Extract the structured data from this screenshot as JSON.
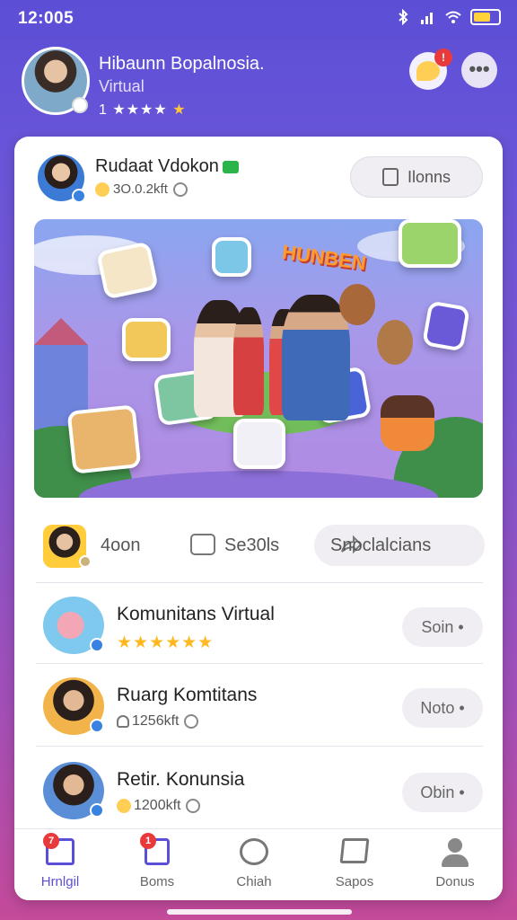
{
  "status_bar": {
    "time": "12:005"
  },
  "header": {
    "name": "Hibaunn Bopalnosia.",
    "subtitle": "Virtual",
    "rating_prefix": "1",
    "rating_stars": "★★★★",
    "rating_gold_star": "★",
    "chat_badge": "!",
    "more_label": "•••"
  },
  "post": {
    "author": "Rudaat Vdokon",
    "meta": "3O.0.2kft",
    "follow_label": "Ilonns",
    "hero_title": "HUNBEN"
  },
  "actions": {
    "like_label": "4oon",
    "comment_label": "Se30ls",
    "share_label": "Snoclalcians"
  },
  "communities": [
    {
      "title": "Komunitans Virtual",
      "sub_stars": "★★★★★★",
      "button": "Soin •"
    },
    {
      "title": "Ruarg Komtitans",
      "sub_text": "1256kft",
      "button": "Noto •"
    },
    {
      "title": "Retir. Konunsia",
      "sub_text": "1200kft",
      "button": "Obin •"
    }
  ],
  "nav": {
    "items": [
      {
        "label": "Hrnlgil",
        "badge": "7"
      },
      {
        "label": "Boms",
        "badge": "1"
      },
      {
        "label": "Chiah"
      },
      {
        "label": "Sapos"
      },
      {
        "label": "Donus"
      }
    ]
  },
  "colors": {
    "accent": "#5a4fd6",
    "badge": "#e83a3a",
    "star": "#ffb81f"
  }
}
